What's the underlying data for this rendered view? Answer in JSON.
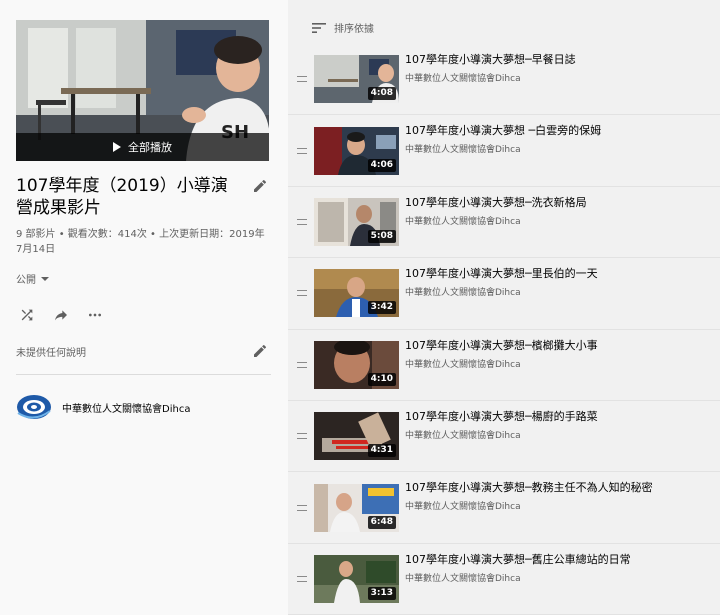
{
  "playlist": {
    "title": "107學年度（2019）小導演營成果影片",
    "play_all_label": "全部播放",
    "meta": "9 部影片 • 觀看次數：414次 • 上次更新日期：2019年7月14日",
    "privacy": "公開",
    "description_placeholder": "未提供任何說明",
    "owner_name": "中華數位人文關懷協會Dihca"
  },
  "sort": {
    "label": "排序依據"
  },
  "videos": [
    {
      "title": "107學年度小導演大夢想─早餐日誌",
      "channel": "中華數位人文關懷協會Dihca",
      "duration": "4:08"
    },
    {
      "title": "107學年度小導演大夢想 ─白雲旁的保姆",
      "channel": "中華數位人文關懷協會Dihca",
      "duration": "4:06"
    },
    {
      "title": "107學年度小導演大夢想─洗衣新格局",
      "channel": "中華數位人文關懷協會Dihca",
      "duration": "5:08"
    },
    {
      "title": "107學年度小導演大夢想─里長伯的一天",
      "channel": "中華數位人文關懷協會Dihca",
      "duration": "3:42"
    },
    {
      "title": "107學年度小導演大夢想─檳榔攤大小事",
      "channel": "中華數位人文關懷協會Dihca",
      "duration": "4:10"
    },
    {
      "title": "107學年度小導演大夢想─楊廚的手路菜",
      "channel": "中華數位人文關懷協會Dihca",
      "duration": "4:31"
    },
    {
      "title": "107學年度小導演大夢想─教務主任不為人知的秘密",
      "channel": "中華數位人文關懷協會Dihca",
      "duration": "6:48"
    },
    {
      "title": "107學年度小導演大夢想─舊庄公車總站的日常",
      "channel": "中華數位人文關懷協會Dihca",
      "duration": "3:13"
    }
  ]
}
